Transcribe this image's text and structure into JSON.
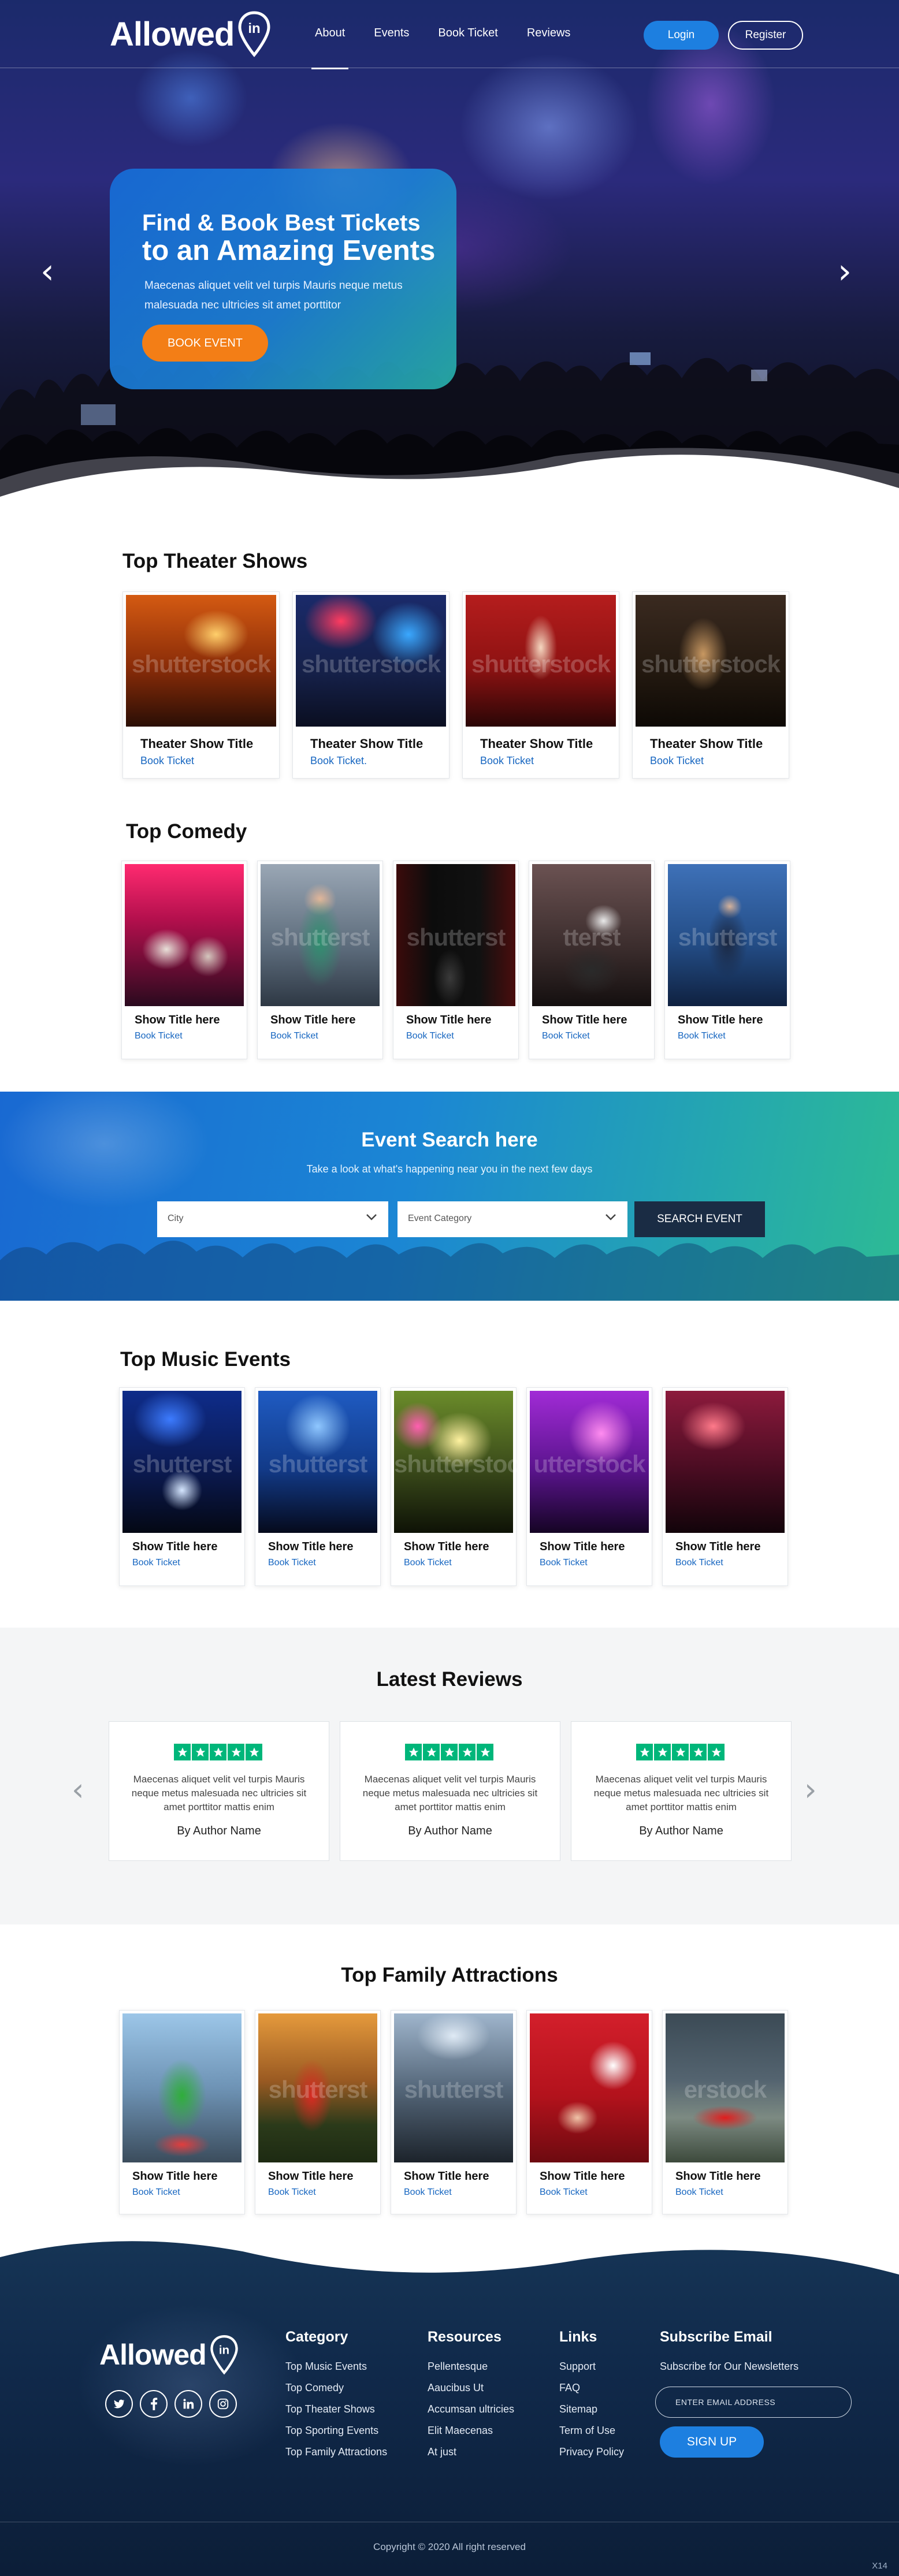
{
  "brand": {
    "name": "Allowed",
    "pin_text": "in"
  },
  "nav": {
    "links": [
      "About",
      "Events",
      "Book Ticket",
      "Reviews"
    ],
    "login_label": "Login",
    "register_label": "Register"
  },
  "hero": {
    "title_line1": "Find & Book Best Tickets",
    "title_line2": "to an Amazing Events",
    "subtitle": "Maecenas aliquet velit vel turpis Mauris neque metus malesuada nec ultricies sit amet porttitor",
    "button_label": "BOOK EVENT"
  },
  "theater": {
    "title": "Top Theater Shows",
    "items": [
      {
        "title": "Theater Show Title",
        "link": "Book Ticket",
        "watermark": "shutterstock"
      },
      {
        "title": "Theater Show Title",
        "link": "Book Ticket.",
        "watermark": "shutterstock"
      },
      {
        "title": "Theater Show Title",
        "link": "Book Ticket",
        "watermark": "shutterstock"
      },
      {
        "title": "Theater Show Title",
        "link": "Book Ticket",
        "watermark": "shutterstock"
      }
    ]
  },
  "comedy": {
    "title": "Top Comedy",
    "items": [
      {
        "title": "Show Title here",
        "link": "Book Ticket",
        "watermark": ""
      },
      {
        "title": "Show Title here",
        "link": "Book Ticket",
        "watermark": "shutterst"
      },
      {
        "title": "Show Title here",
        "link": "Book Ticket",
        "watermark": "shutterst"
      },
      {
        "title": "Show Title here",
        "link": "Book Ticket",
        "watermark": "tterst"
      },
      {
        "title": "Show Title here",
        "link": "Book Ticket",
        "watermark": "shutterst"
      }
    ]
  },
  "search": {
    "title": "Event Search here",
    "subtitle": "Take a look at what's happening near you in the next few days",
    "city_label": "City",
    "category_label": "Event Category",
    "button_label": "SEARCH EVENT"
  },
  "music": {
    "title": "Top Music Events",
    "items": [
      {
        "title": "Show Title here",
        "link": "Book Ticket",
        "watermark": "shutterst"
      },
      {
        "title": "Show Title here",
        "link": "Book Ticket",
        "watermark": "shutterst"
      },
      {
        "title": "Show Title here",
        "link": "Book Ticket",
        "watermark": "shutterstock"
      },
      {
        "title": "Show Title here",
        "link": "Book Ticket",
        "watermark": "utterstock"
      },
      {
        "title": "Show Title here",
        "link": "Book Ticket",
        "watermark": ""
      }
    ]
  },
  "reviews": {
    "title": "Latest Reviews",
    "items": [
      {
        "text": "Maecenas aliquet velit vel turpis Mauris neque metus malesuada nec ultricies sit amet porttitor mattis enim",
        "author": "By Author Name",
        "stars": 5
      },
      {
        "text": "Maecenas aliquet velit vel turpis Mauris neque metus malesuada nec ultricies sit amet porttitor mattis enim",
        "author": "By Author Name",
        "stars": 5
      },
      {
        "text": "Maecenas aliquet velit vel turpis Mauris neque metus malesuada nec ultricies sit amet porttitor mattis enim",
        "author": "By Author Name",
        "stars": 5
      }
    ]
  },
  "family": {
    "title": "Top Family Attractions",
    "items": [
      {
        "title": "Show Title here",
        "link": "Book Ticket",
        "watermark": ""
      },
      {
        "title": "Show Title here",
        "link": "Book Ticket",
        "watermark": "shutterst"
      },
      {
        "title": "Show Title here",
        "link": "Book Ticket",
        "watermark": "shutterst"
      },
      {
        "title": "Show Title here",
        "link": "Book Ticket",
        "watermark": ""
      },
      {
        "title": "Show Title here",
        "link": "Book Ticket",
        "watermark": "erstock"
      }
    ]
  },
  "footer": {
    "social_icons": [
      "twitter-icon",
      "facebook-icon",
      "linkedin-icon",
      "instagram-icon"
    ],
    "columns": [
      {
        "heading": "Category",
        "items": [
          "Top Music Events",
          "Top Comedy",
          "Top Theater Shows",
          "Top Sporting Events",
          "Top Family Attractions"
        ]
      },
      {
        "heading": "Resources",
        "items": [
          "Pellentesque",
          "Aaucibus Ut",
          "Accumsan ultricies",
          "Elit Maecenas",
          "At just"
        ]
      },
      {
        "heading": "Links",
        "items": [
          "Support",
          "FAQ",
          "Sitemap",
          "Term of Use",
          "Privacy Policy"
        ]
      }
    ],
    "subscribe": {
      "heading": "Subscribe Email",
      "text": "Subscribe for Our Newsletters",
      "placeholder": "ENTER EMAIL ADDRESS",
      "button_label": "SIGN UP"
    },
    "copyright": "Copyright © 2020 All right reserved",
    "corner_mark": "X14"
  },
  "colors": {
    "primary_blue": "#1d7fe0",
    "orange": "#f37e16",
    "link_blue": "#1565c0",
    "trustpilot_green": "#00b67a",
    "footer_navy": "#10294a"
  }
}
